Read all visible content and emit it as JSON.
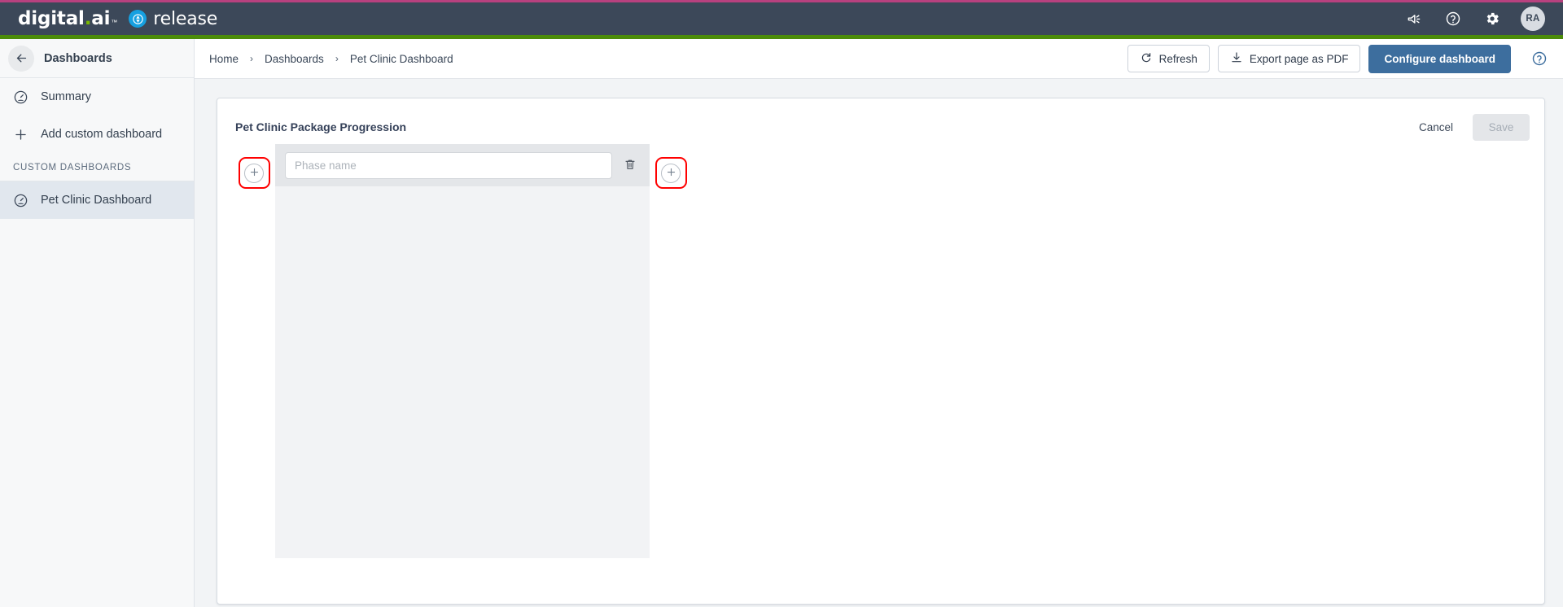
{
  "brand": {
    "product_name": "digital.ai",
    "trademark": "™",
    "module_name": "release",
    "module_icon": "release-logo-icon"
  },
  "header": {
    "icons": [
      {
        "name": "announcements-icon",
        "label": "Announcements"
      },
      {
        "name": "help-icon",
        "label": "Help"
      },
      {
        "name": "settings-gear-icon",
        "label": "Settings"
      }
    ],
    "avatar_initials": "RA"
  },
  "sidebar": {
    "back_label": "Dashboards",
    "back_icon": "arrow-left-icon",
    "items": [
      {
        "label": "Summary",
        "icon": "gauge-icon",
        "active": false
      },
      {
        "label": "Add custom dashboard",
        "icon": "plus-icon",
        "active": false
      }
    ],
    "section_label": "CUSTOM DASHBOARDS",
    "custom_dashboards": [
      {
        "label": "Pet Clinic Dashboard",
        "icon": "gauge-icon",
        "active": true
      }
    ]
  },
  "toolbar": {
    "breadcrumb": [
      "Home",
      "Dashboards",
      "Pet Clinic Dashboard"
    ],
    "breadcrumb_separator": "›",
    "refresh_label": "Refresh",
    "refresh_icon": "refresh-icon",
    "export_label": "Export page as PDF",
    "export_icon": "download-icon",
    "configure_label": "Configure dashboard",
    "help_icon": "help-circle-icon"
  },
  "panel": {
    "title": "Pet Clinic Package Progression",
    "cancel_label": "Cancel",
    "save_label": "Save",
    "save_disabled": true
  },
  "phase_editor": {
    "add_button_left": {
      "icon": "plus-icon",
      "highlighted": true
    },
    "add_button_right": {
      "icon": "plus-icon",
      "highlighted": true
    },
    "highlight_color": "#ff0000",
    "phases": [
      {
        "name_value": "",
        "name_placeholder": "Phase name",
        "delete_icon": "trash-icon",
        "tasks": []
      }
    ]
  },
  "colors": {
    "accent_magenta": "#b8417f",
    "header_navy": "#3c4859",
    "accent_green": "#4c8c0a",
    "primary_blue": "#3d6e9e",
    "logo_dot_green": "#7ab800",
    "release_badge_blue": "#16a0e0",
    "page_background": "#f2f4f6"
  }
}
